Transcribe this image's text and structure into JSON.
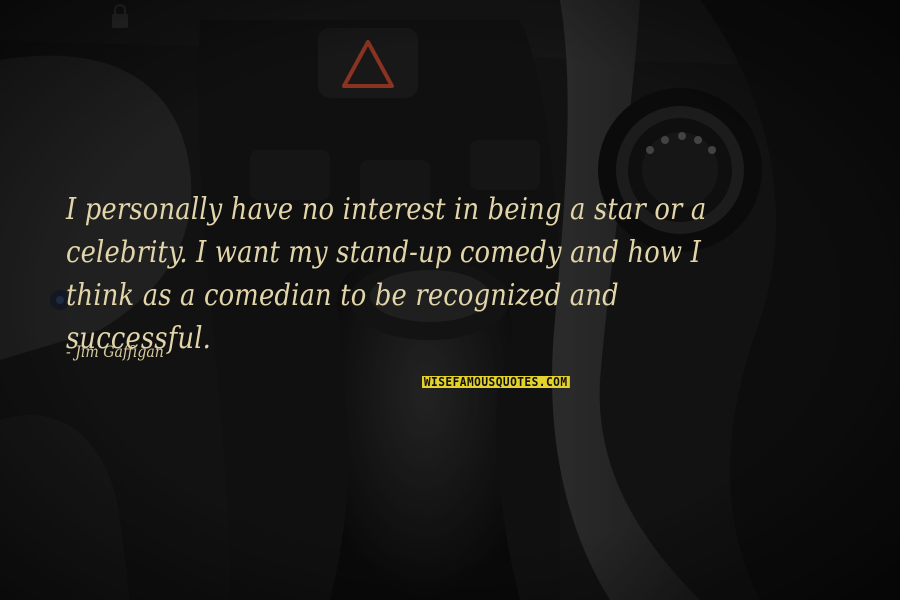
{
  "quote": {
    "text": "I personally have no interest in being a star or a celebrity. I want my stand-up comedy and how I think as a comedian to be recognized and successful.",
    "author": "- Jim Gaffigan"
  },
  "watermark": {
    "text": "WISEFAMOUSQUOTES.COM"
  },
  "colors": {
    "quote_text": "#e2d5a9",
    "logo_background": "#e3d22a",
    "hazard_icon": "#b8452c"
  },
  "background": {
    "description_icons": [
      "hazard-triangle-icon",
      "lock-icon",
      "gear-shift-knob",
      "rotary-dial-knob"
    ]
  }
}
